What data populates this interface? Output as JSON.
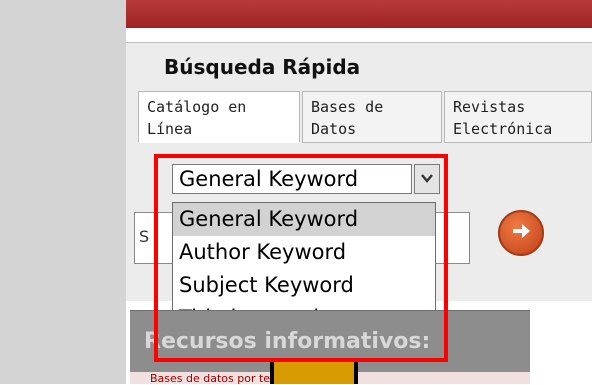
{
  "quick_search": {
    "title": "Búsqueda Rápida",
    "tabs": [
      {
        "line1": "Catálogo en",
        "line2": "Línea"
      },
      {
        "line1": "Bases de",
        "line2": "Datos"
      },
      {
        "line1": "Revistas",
        "line2": "Electrónica"
      }
    ],
    "select": {
      "selected": "General Keyword",
      "options": [
        "General Keyword",
        "Author Keyword",
        "Subject Keyword",
        "Title keyword"
      ]
    },
    "search_input_value": "S",
    "go_icon": "arrow-right-circle-icon"
  },
  "info_section": {
    "heading": "Recursos informativos:",
    "link_text": "Bases de datos por tema"
  },
  "colors": {
    "highlight": "#ff0000",
    "banner": "#9e2323",
    "go_button": "#c2401a"
  }
}
